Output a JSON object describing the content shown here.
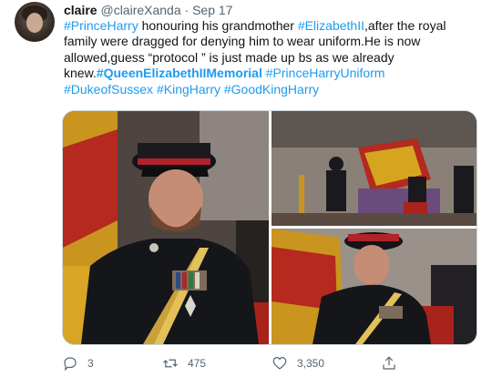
{
  "tweet": {
    "name": "claire",
    "handle": "@claireXanda",
    "separator": "·",
    "date": "Sep 17",
    "text_parts": [
      {
        "t": "tag",
        "v": "#PrinceHarry"
      },
      {
        "t": "txt",
        "v": " honouring his grandmother "
      },
      {
        "t": "tag",
        "v": "#ElizabethII"
      },
      {
        "t": "txt",
        "v": ",after the royal family were dragged for denying him to wear uniform.He is now allowed,guess “protocol ” is just made up bs as we already knew."
      },
      {
        "t": "tagb",
        "v": "#QueenElizabethIIMemorial"
      },
      {
        "t": "txt",
        "v": " "
      },
      {
        "t": "tag",
        "v": "#PrinceHarryUniform"
      },
      {
        "t": "txt",
        "v": " "
      },
      {
        "t": "tag",
        "v": "#DukeofSussex"
      },
      {
        "t": "txt",
        "v": " "
      },
      {
        "t": "tag",
        "v": "#KingHarry"
      },
      {
        "t": "txt",
        "v": " "
      },
      {
        "t": "tag",
        "v": "#GoodKingHarry"
      }
    ],
    "actions": {
      "replies": "3",
      "retweets": "475",
      "likes": "3,350"
    }
  },
  "colors": {
    "link": "#1d9bf0",
    "muted": "#536471",
    "text": "#0f1419"
  }
}
